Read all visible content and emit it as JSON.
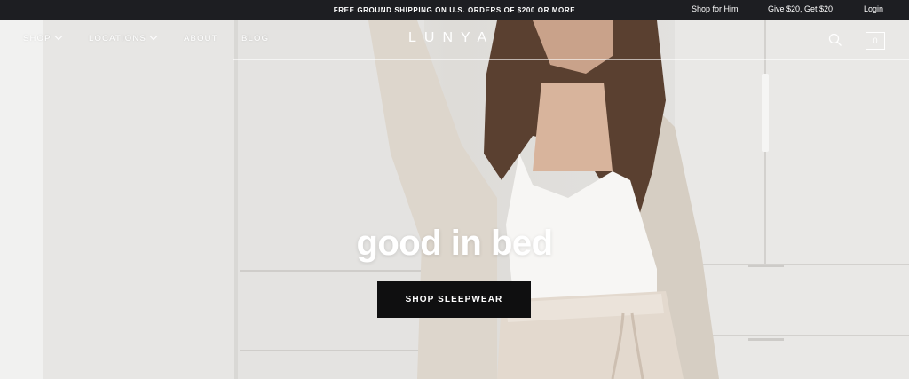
{
  "announcement": {
    "promo_text": "FREE GROUND SHIPPING ON U.S. ORDERS OF $200 OR MORE",
    "links": [
      "Shop for Him",
      "Give $20, Get $20",
      "Login"
    ]
  },
  "nav": {
    "brand": "LUNYA",
    "items": [
      {
        "label": "SHOP",
        "dropdown": true
      },
      {
        "label": "LOCATIONS",
        "dropdown": true
      },
      {
        "label": "ABOUT",
        "dropdown": false
      },
      {
        "label": "BLOG",
        "dropdown": false
      }
    ],
    "cart_count": "0",
    "icons": [
      "search-icon",
      "cart-icon"
    ]
  },
  "hero": {
    "headline": "good in bed",
    "cta_label": "SHOP SLEEPWEAR"
  },
  "colors": {
    "topbar": "#1d1e22",
    "cta": "#0f0f10",
    "text_on_hero": "#ffffff"
  }
}
